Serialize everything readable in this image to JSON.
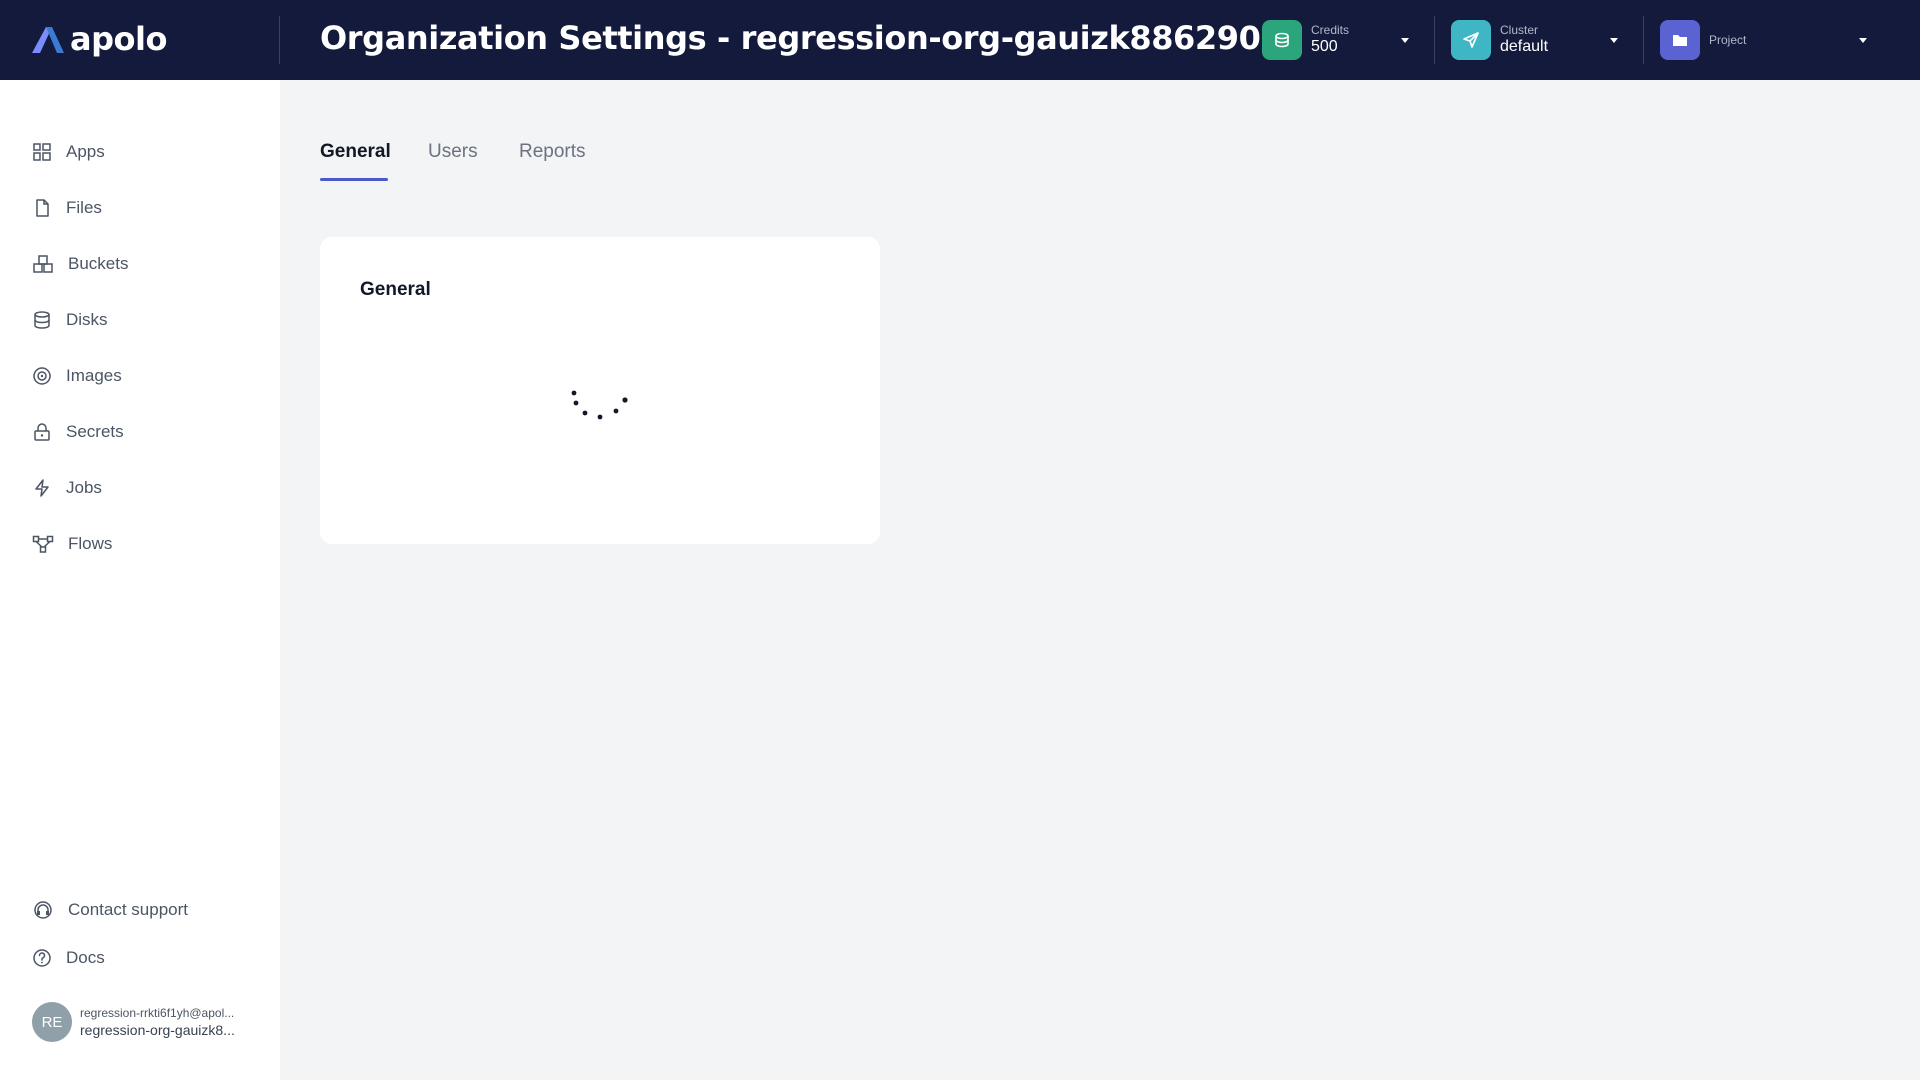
{
  "header": {
    "logo_text": "apolo",
    "title": "Organization Settings - regression-org-gauizk886290",
    "credits": {
      "label": "Credits",
      "value": "500",
      "icon": "coins-icon",
      "color": "#2aa57c"
    },
    "cluster": {
      "label": "Cluster",
      "value": "default",
      "icon": "send-icon",
      "color": "#3fb6c4"
    },
    "project": {
      "label": "Project",
      "value": "",
      "icon": "folder-icon",
      "color": "#5b63d3"
    }
  },
  "sidebar": {
    "items": [
      {
        "label": "Apps",
        "icon": "apps-grid-icon"
      },
      {
        "label": "Files",
        "icon": "file-icon"
      },
      {
        "label": "Buckets",
        "icon": "buckets-icon"
      },
      {
        "label": "Disks",
        "icon": "database-icon"
      },
      {
        "label": "Images",
        "icon": "image-disc-icon"
      },
      {
        "label": "Secrets",
        "icon": "lock-icon"
      },
      {
        "label": "Jobs",
        "icon": "lightning-icon"
      },
      {
        "label": "Flows",
        "icon": "flow-icon"
      }
    ],
    "footer": [
      {
        "label": "Contact support",
        "icon": "headset-icon"
      },
      {
        "label": "Docs",
        "icon": "help-circle-icon"
      }
    ],
    "user": {
      "initials": "RE",
      "email": "regression-rrkti6f1yh@apol...",
      "org": "regression-org-gauizk8..."
    }
  },
  "tabs": [
    {
      "label": "General",
      "active": true
    },
    {
      "label": "Users",
      "active": false
    },
    {
      "label": "Reports",
      "active": false
    }
  ],
  "card": {
    "title": "General",
    "loading": true
  },
  "colors": {
    "header_bg": "#141a3c",
    "accent": "#4c58c7",
    "page_bg": "#f3f4f6"
  }
}
